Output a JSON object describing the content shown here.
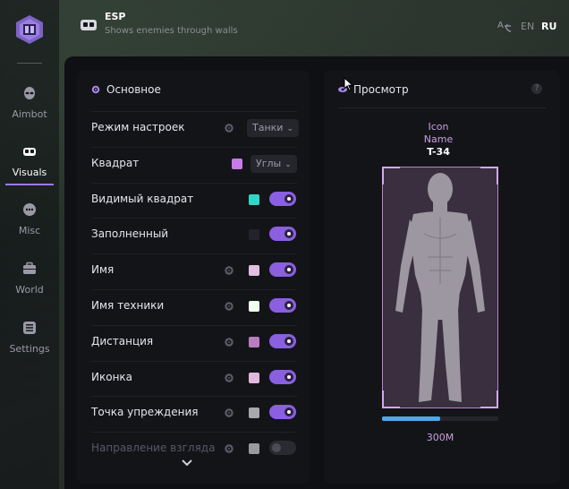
{
  "sidebar": {
    "items": [
      {
        "label": "Aimbot",
        "icon": "alien-icon"
      },
      {
        "label": "Visuals",
        "icon": "goggles-icon",
        "active": true
      },
      {
        "label": "Misc",
        "icon": "dots-icon"
      },
      {
        "label": "World",
        "icon": "briefcase-icon"
      },
      {
        "label": "Settings",
        "icon": "list-icon"
      }
    ]
  },
  "header": {
    "title": "ESP",
    "subtitle": "Shows enemies through walls",
    "lang_en": "EN",
    "lang_ru": "RU"
  },
  "settings": {
    "section_title": "Основное",
    "rows": [
      {
        "label": "Режим настроек",
        "select": "Танки"
      },
      {
        "label": "Квадрат",
        "select": "Углы",
        "color": "#c77be8"
      },
      {
        "label": "Видимый квадрат",
        "color": "#2fd6c6",
        "toggle": true
      },
      {
        "label": "Заполненный",
        "color": "#24222a",
        "toggle": true
      },
      {
        "label": "Имя",
        "color": "#e2bfe0",
        "toggle": true
      },
      {
        "label": "Имя техники",
        "color": "#f1fff0",
        "toggle": true
      },
      {
        "label": "Дистанция",
        "color": "#b87cbf",
        "toggle": true
      },
      {
        "label": "Иконка",
        "color": "#e2b8dc",
        "toggle": true
      },
      {
        "label": "Точка упреждения",
        "color": "#a8a8ac",
        "toggle": true
      },
      {
        "label": "Направление взгляда",
        "color": "#9a9a9c",
        "toggle": false
      }
    ]
  },
  "preview": {
    "title": "Просмотр",
    "help": "?",
    "icon_label": "Icon",
    "name_label": "Name",
    "vehicle": "T-34",
    "distance": "300M",
    "distance_fraction": 0.5
  },
  "colors": {
    "accent": "#8a5fe0",
    "box_border": "#b584c9"
  }
}
